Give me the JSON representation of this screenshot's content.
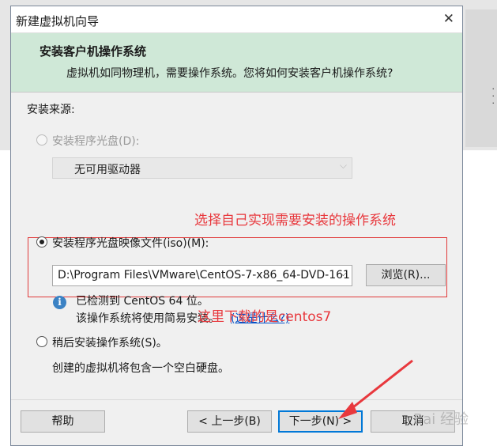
{
  "window": {
    "title": "新建虚拟机向导",
    "close_glyph": "✕"
  },
  "header": {
    "title": "安装客户机操作系统",
    "subtitle": "虚拟机如同物理机，需要操作系统。您将如何安装客户机操作系统?"
  },
  "install_source": {
    "label": "安装来源:",
    "options": [
      {
        "label": "安装程序光盘(D):",
        "state": "disabled"
      },
      {
        "label": "安装程序光盘映像文件(iso)(M):",
        "state": "selected"
      },
      {
        "label": "稍后安装操作系统(S)。",
        "state": "unselected"
      }
    ],
    "disc_drive_select": {
      "value": "无可用驱动器"
    },
    "iso_path_select": {
      "value": "D:\\Program Files\\VMware\\CentOS-7-x86_64-DVD-161"
    },
    "browse_button": "浏览(R)...",
    "detected_line1": "已检测到 CentOS 64 位。",
    "detected_line2": "该操作系统将使用简易安装。",
    "what_is_this_link": "(这是什么?)",
    "later_desc": "创建的虚拟机将包含一个空白硬盘。"
  },
  "buttons": {
    "help": "帮助",
    "back": "< 上一步(B)",
    "next": "下一步(N) >",
    "cancel": "取消"
  },
  "annotations": {
    "choose_os": "选择自己实现需要安装的操作系统",
    "downloaded": "这里下载的是centos7"
  },
  "watermark": "Bai 经验"
}
